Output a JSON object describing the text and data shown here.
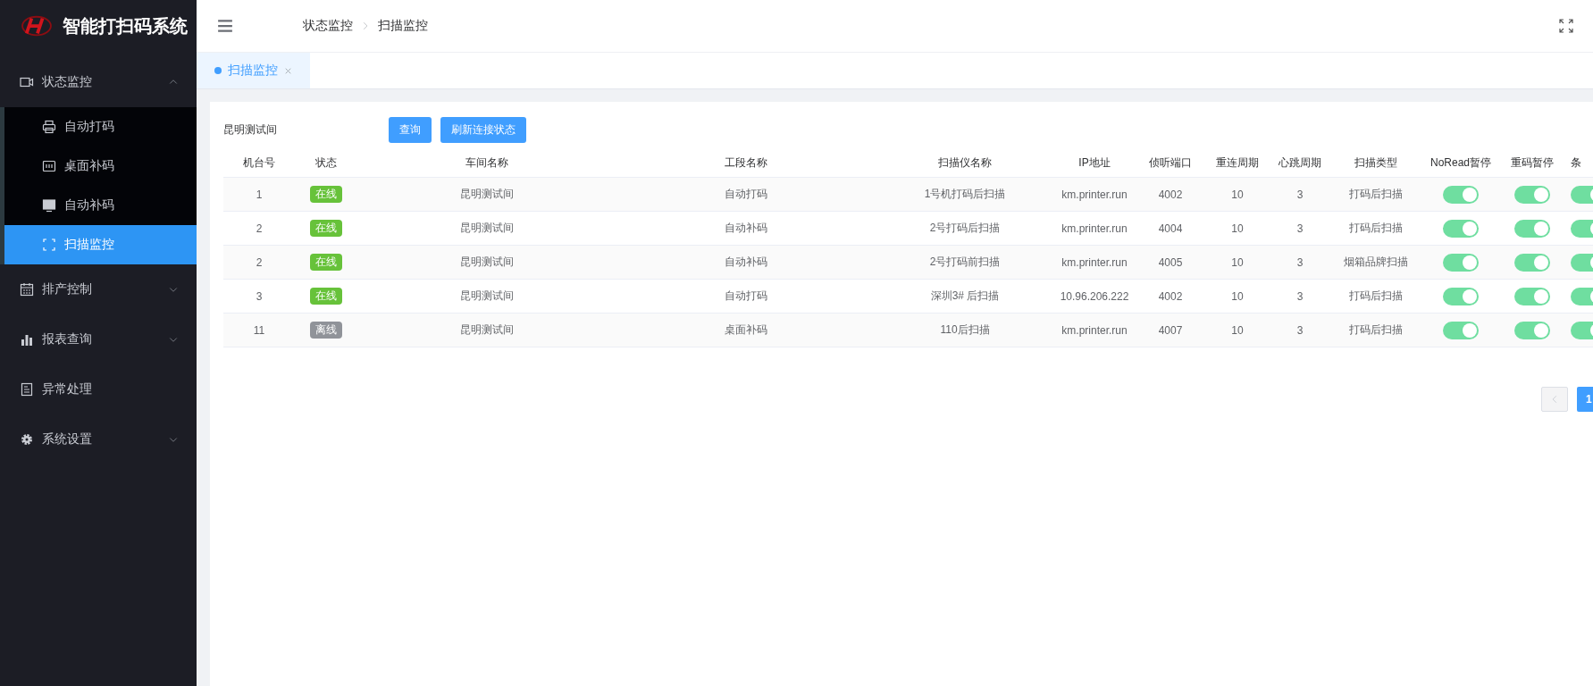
{
  "sidebar": {
    "logo_text": "智能打扫码系统",
    "items": [
      {
        "label": "状态监控",
        "expanded": true,
        "selected": false,
        "children": [
          {
            "label": "自动打码",
            "selected": false
          },
          {
            "label": "桌面补码",
            "selected": false
          },
          {
            "label": "自动补码",
            "selected": false
          },
          {
            "label": "扫描监控",
            "selected": true
          }
        ]
      },
      {
        "label": "排产控制",
        "expanded": false,
        "selected": false
      },
      {
        "label": "报表查询",
        "expanded": false,
        "selected": false
      },
      {
        "label": "异常处理",
        "selected": false
      },
      {
        "label": "系统设置",
        "expanded": false,
        "selected": false
      }
    ]
  },
  "header": {
    "breadcrumb": [
      "状态监控",
      "扫描监控"
    ]
  },
  "tabs": [
    {
      "label": "扫描监控",
      "selected": true
    }
  ],
  "filter": {
    "workshop": "昆明测试间",
    "buttons": [
      "查询",
      "刷新连接状态"
    ]
  },
  "table": {
    "columns": [
      "机台号",
      "状态",
      "车间名称",
      "工段名称",
      "扫描仪名称",
      "IP地址",
      "侦听端口",
      "重连周期",
      "心跳周期",
      "扫描类型",
      "NoRead暂停",
      "重码暂停",
      "条"
    ],
    "rows": [
      {
        "machine": "1",
        "status": "在线",
        "online": true,
        "workshop": "昆明测试间",
        "section": "自动打码",
        "scanner": "1号机打码后扫描",
        "ip": "km.printer.run",
        "port": "4002",
        "reconnect": "10",
        "heartbeat": "3",
        "scan_type": "打码后扫描",
        "noread_pause": true,
        "duplicate_pause": true,
        "column_13": true
      },
      {
        "machine": "2",
        "status": "在线",
        "online": true,
        "workshop": "昆明测试间",
        "section": "自动补码",
        "scanner": "2号打码后扫描",
        "ip": "km.printer.run",
        "port": "4004",
        "reconnect": "10",
        "heartbeat": "3",
        "scan_type": "打码后扫描",
        "noread_pause": true,
        "duplicate_pause": true,
        "column_13": true
      },
      {
        "machine": "2",
        "status": "在线",
        "online": true,
        "workshop": "昆明测试间",
        "section": "自动补码",
        "scanner": "2号打码前扫描",
        "ip": "km.printer.run",
        "port": "4005",
        "reconnect": "10",
        "heartbeat": "3",
        "scan_type": "烟箱品牌扫描",
        "noread_pause": true,
        "duplicate_pause": true,
        "column_13": true
      },
      {
        "machine": "3",
        "status": "在线",
        "online": true,
        "workshop": "昆明测试间",
        "section": "自动打码",
        "scanner": "深圳3# 后扫描",
        "ip": "10.96.206.222",
        "port": "4002",
        "reconnect": "10",
        "heartbeat": "3",
        "scan_type": "打码后扫描",
        "noread_pause": true,
        "duplicate_pause": true,
        "column_13": true
      },
      {
        "machine": "11",
        "status": "离线",
        "online": false,
        "workshop": "昆明测试间",
        "section": "桌面补码",
        "scanner": "110后扫描",
        "ip": "km.printer.run",
        "port": "4007",
        "reconnect": "10",
        "heartbeat": "3",
        "scan_type": "打码后扫描",
        "noread_pause": true,
        "duplicate_pause": true,
        "column_13": true
      }
    ]
  },
  "pagination": {
    "pages": [
      {
        "label": "1",
        "selected": true
      }
    ]
  }
}
